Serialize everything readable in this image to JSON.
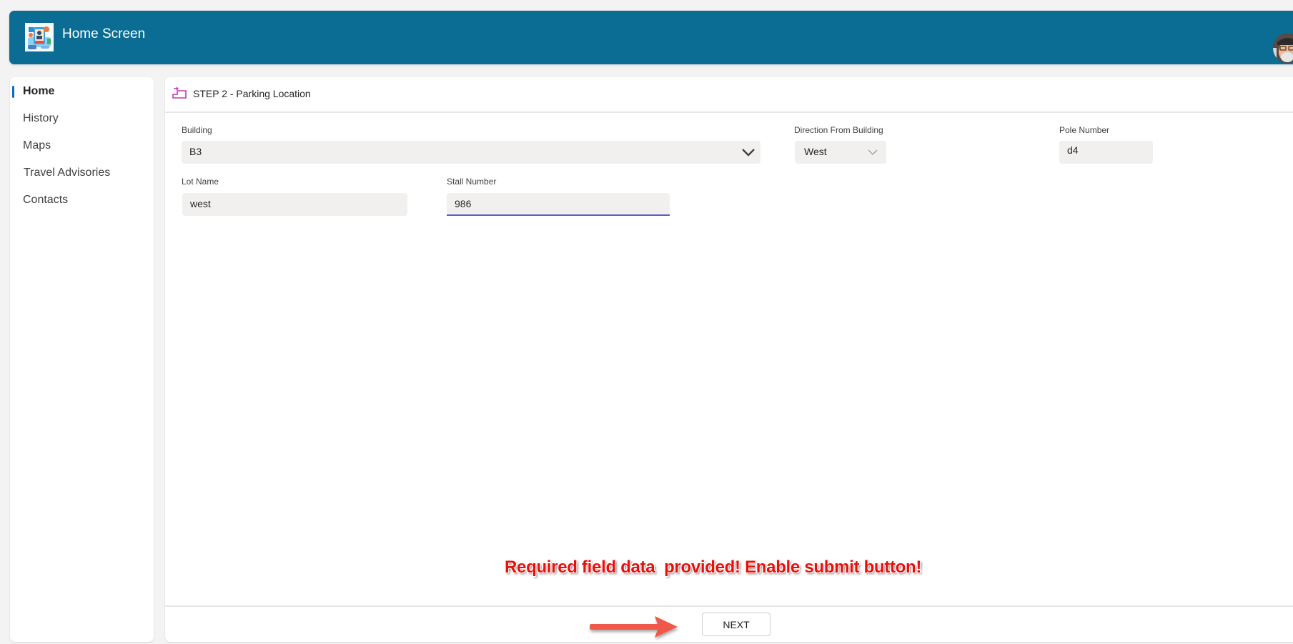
{
  "header": {
    "title": "Home Screen",
    "logo_icon": "parking-app-logo",
    "avatar_icon": "user-avatar",
    "background_color": "#0b6c94"
  },
  "sidebar": {
    "items": [
      {
        "label": "Home",
        "active": true
      },
      {
        "label": "History",
        "active": false
      },
      {
        "label": "Maps",
        "active": false
      },
      {
        "label": "Travel Advisories",
        "active": false
      },
      {
        "label": "Contacts",
        "active": false
      }
    ],
    "active_color": "#0f6cbd"
  },
  "step": {
    "title": "STEP 2 - Parking Location",
    "icon": "stairs-step-icon",
    "icon_color": "#c239b3"
  },
  "form": {
    "building": {
      "label": "Building",
      "value": "B3"
    },
    "direction": {
      "label": "Direction From Building",
      "value": "West"
    },
    "pole_number": {
      "label": "Pole Number",
      "value": "d4"
    },
    "lot_name": {
      "label": "Lot Name",
      "value": "west"
    },
    "stall_number": {
      "label": "Stall Number",
      "value": "986"
    }
  },
  "annotation": {
    "text": "Required field data  provided! Enable submit button!",
    "color": "#e8100a"
  },
  "footer": {
    "next_label": "NEXT",
    "arrow_color": "#f0584a"
  }
}
